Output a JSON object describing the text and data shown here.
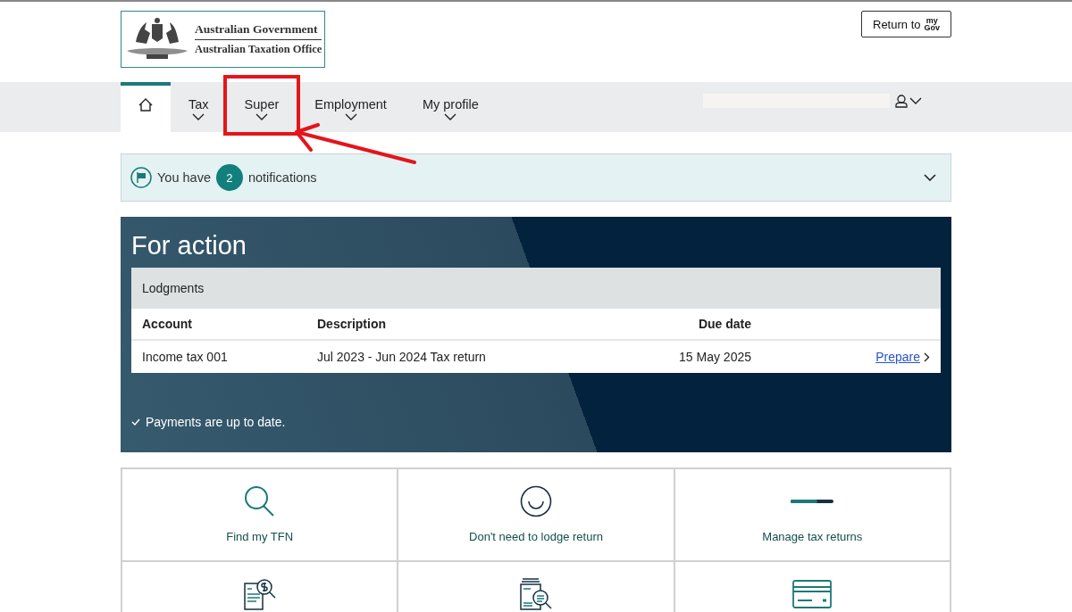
{
  "header": {
    "logo": {
      "line1": "Australian Government",
      "line2": "Australian Taxation Office"
    },
    "return_button": {
      "label": "Return to",
      "brand_top": "my",
      "brand_bottom": "Gov"
    }
  },
  "nav": {
    "items": [
      {
        "kind": "home",
        "selected": true,
        "highlighted": false
      },
      {
        "kind": "menu",
        "label": "Tax",
        "selected": false,
        "highlighted": false
      },
      {
        "kind": "menu",
        "label": "Super",
        "selected": false,
        "highlighted": true
      },
      {
        "kind": "menu",
        "label": "Employment",
        "selected": false,
        "highlighted": false
      },
      {
        "kind": "menu",
        "label": "My profile",
        "selected": false,
        "highlighted": false
      }
    ]
  },
  "notifications": {
    "prefix": "You have",
    "count": "2",
    "suffix": "notifications",
    "expanded": false
  },
  "for_action": {
    "title": "For action",
    "table": {
      "title": "Lodgments",
      "columns": [
        "Account",
        "Description",
        "Due date"
      ],
      "rows": [
        {
          "account": "Income tax 001",
          "description": "Jul 2023 - Jun 2024 Tax return",
          "due_date": "15 May 2025",
          "action": "Prepare"
        }
      ]
    },
    "status": "Payments are up to date."
  },
  "tiles": [
    {
      "kind": "search",
      "label": "Find my TFN"
    },
    {
      "kind": "smile",
      "label": "Don't need to lodge return"
    },
    {
      "kind": "progress",
      "label": "Manage tax returns"
    },
    {
      "kind": "document-dollar"
    },
    {
      "kind": "document-search"
    },
    {
      "kind": "card"
    }
  ]
}
